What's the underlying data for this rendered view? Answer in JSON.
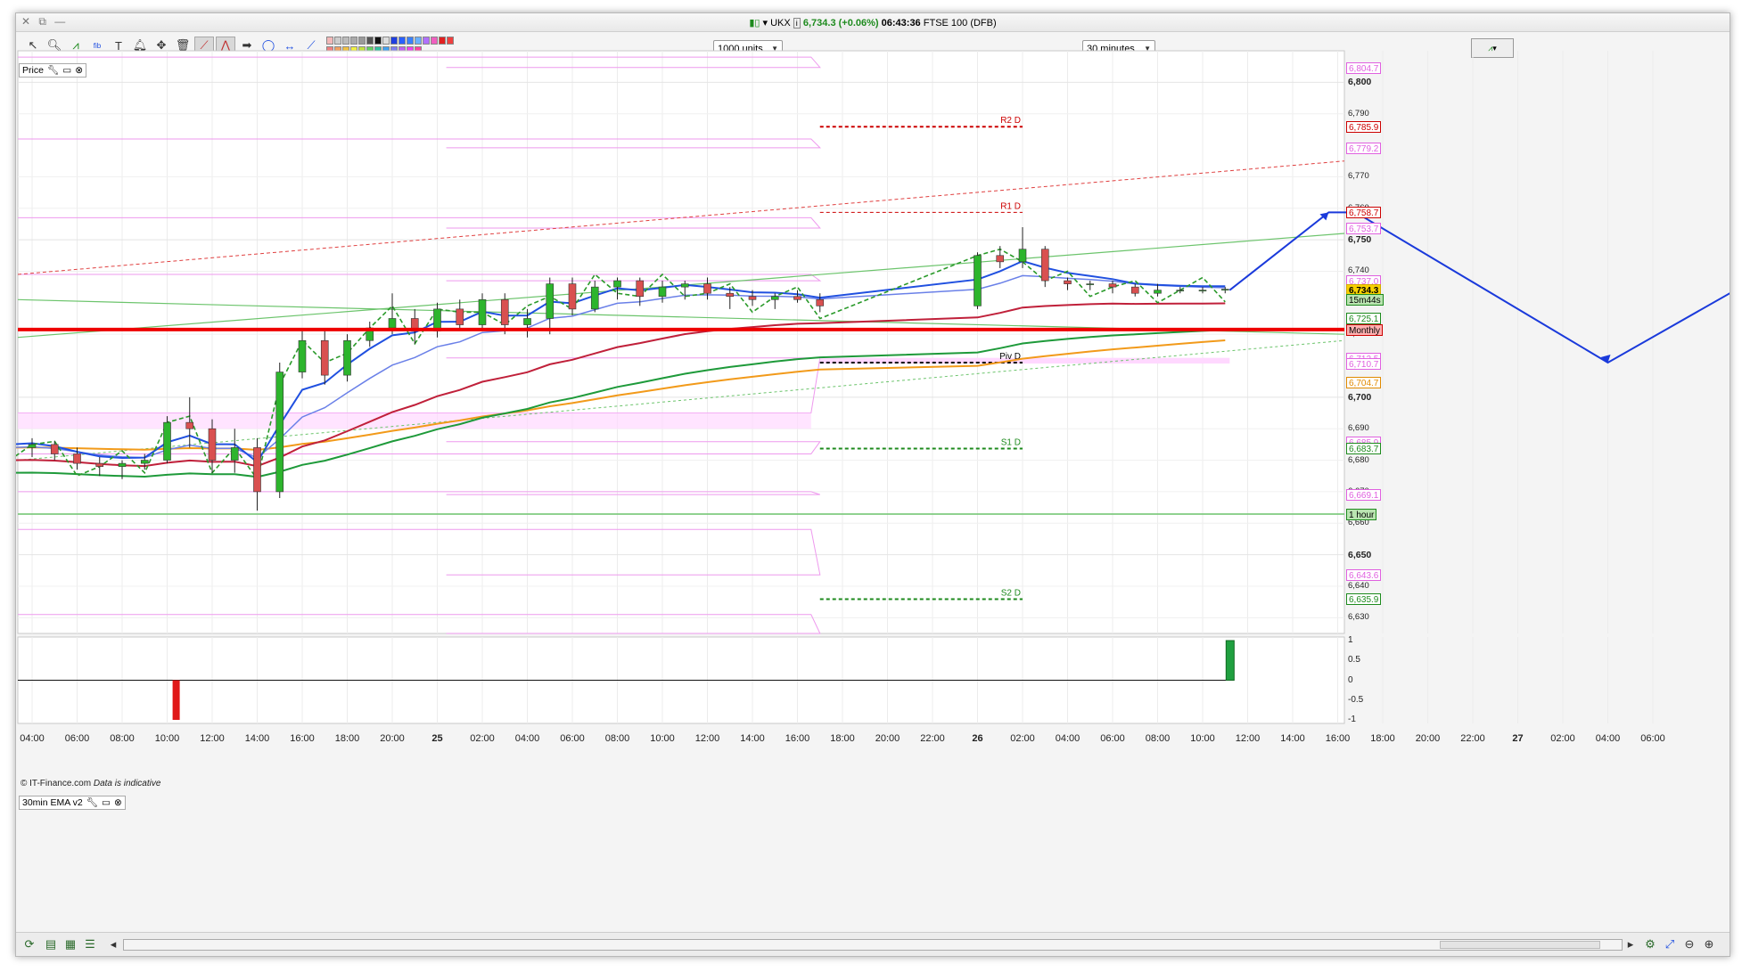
{
  "window": {
    "title_symbol": "UKX",
    "title_price": "6,734.3",
    "title_change": "(+0.06%)",
    "title_time": "06:43:36",
    "title_name": "FTSE 100 (DFB)"
  },
  "toolbar": {
    "units_select": "1000 units",
    "interval_select": "30 minutes"
  },
  "price_panel": {
    "label": "Price",
    "copyright": "© IT-Finance.com",
    "disclaimer": "Data is indicative"
  },
  "indicator_panel": {
    "label": "30min EMA v2",
    "ticks": [
      "1",
      "0.5",
      "0",
      "-0.5",
      "-1"
    ],
    "ylim": [
      -1,
      1
    ]
  },
  "price_axis": {
    "ylim": [
      6625,
      6810
    ],
    "major_ticks": [
      "6,800",
      "6,750",
      "6,700",
      "6,650"
    ],
    "minor_ticks": [
      "6,790",
      "6,770",
      "6,760",
      "6,740",
      "6,720",
      "6,690",
      "6,680",
      "6,670",
      "6,660",
      "6,640",
      "6,630"
    ],
    "major_values": [
      6800,
      6750,
      6700,
      6650
    ],
    "minor_values": [
      6790,
      6770,
      6760,
      6740,
      6720,
      6690,
      6680,
      6670,
      6660,
      6640,
      6630
    ],
    "tags": [
      {
        "text": "6,804.7",
        "value": 6804.7,
        "color": "#e060e0"
      },
      {
        "text": "6,785.9",
        "value": 6785.9,
        "color": "#cc0000"
      },
      {
        "text": "6,779.2",
        "value": 6779.2,
        "color": "#e060e0"
      },
      {
        "text": "6,758.7",
        "value": 6758.7,
        "color": "#cc0000"
      },
      {
        "text": "6,753.7",
        "value": 6753.7,
        "color": "#e060e0"
      },
      {
        "text": "6,737.0",
        "value": 6737.0,
        "color": "#e060e0"
      },
      {
        "text": "6,734.3",
        "value": 6734.3,
        "color": "#d4a800"
      },
      {
        "text": "15m44s",
        "value": 6731.0,
        "color": "#1d8a1d"
      },
      {
        "text": "6,725.1",
        "value": 6725.1,
        "color": "#1d8a1d"
      },
      {
        "text": "Monthly",
        "value": 6721.5,
        "color": "#cc0000"
      },
      {
        "text": "6,712.5",
        "value": 6712.5,
        "color": "#e060e0"
      },
      {
        "text": "6,710.7",
        "value": 6710.7,
        "color": "#e060e0"
      },
      {
        "text": "6,704.7",
        "value": 6704.7,
        "color": "#e08a00"
      },
      {
        "text": "6,685.9",
        "value": 6685.9,
        "color": "#e060e0"
      },
      {
        "text": "6,683.7",
        "value": 6683.7,
        "color": "#1d8a1d"
      },
      {
        "text": "6,669.1",
        "value": 6669.1,
        "color": "#e060e0"
      },
      {
        "text": "1 hour",
        "value": 6662.9,
        "color": "#1d8a1d"
      },
      {
        "text": "6,643.6",
        "value": 6643.6,
        "color": "#e060e0"
      },
      {
        "text": "6,635.9",
        "value": 6635.9,
        "color": "#1d8a1d"
      }
    ]
  },
  "pivots": [
    {
      "label": "R2 D",
      "value": 6785.9,
      "color": "#cc0000"
    },
    {
      "label": "R1 D",
      "value": 6758.7,
      "color": "#cc0000"
    },
    {
      "label": "Piv D",
      "value": 6711.0,
      "color": "#000000"
    },
    {
      "label": "S1 D",
      "value": 6683.7,
      "color": "#1d8a1d"
    },
    {
      "label": "S2 D",
      "value": 6635.9,
      "color": "#1d8a1d"
    }
  ],
  "time_axis": {
    "labels": [
      "04:00",
      "06:00",
      "08:00",
      "10:00",
      "12:00",
      "14:00",
      "16:00",
      "18:00",
      "20:00",
      "25",
      "02:00",
      "04:00",
      "06:00",
      "08:00",
      "10:00",
      "12:00",
      "14:00",
      "16:00",
      "18:00",
      "20:00",
      "22:00",
      "26",
      "02:00",
      "04:00",
      "06:00",
      "08:00",
      "10:00",
      "12:00",
      "14:00",
      "16:00",
      "18:00",
      "20:00",
      "22:00",
      "27",
      "02:00",
      "04:00",
      "06:00"
    ],
    "day_labels": [
      "25",
      "26",
      "27"
    ]
  },
  "colors": {
    "bull": "#2db52d",
    "bear": "#d95050",
    "monthly_line": "#ee0000",
    "forecast_arrow": "#1a3adb",
    "ema_fast": "#2050e0",
    "ema_slow": "#1e9a3a",
    "ema_long": "#f29a1a",
    "ema_red": "#c0203a",
    "pivot_band": "#ee99ee"
  },
  "chart_data": {
    "type": "candlestick",
    "candles": [
      {
        "t": "03:30",
        "o": 6686,
        "h": 6690,
        "l": 6682,
        "c": 6684
      },
      {
        "t": "04:00",
        "o": 6684,
        "h": 6687,
        "l": 6681,
        "c": 6685
      },
      {
        "t": "04:30",
        "o": 6685,
        "h": 6686,
        "l": 6680,
        "c": 6682
      },
      {
        "t": "05:00",
        "o": 6682,
        "h": 6684,
        "l": 6677,
        "c": 6679
      },
      {
        "t": "05:30",
        "o": 6679,
        "h": 6681,
        "l": 6675,
        "c": 6678
      },
      {
        "t": "06:00",
        "o": 6678,
        "h": 6680,
        "l": 6674,
        "c": 6679
      },
      {
        "t": "06:30",
        "o": 6679,
        "h": 6682,
        "l": 6677,
        "c": 6680
      },
      {
        "t": "07:00",
        "o": 6680,
        "h": 6694,
        "l": 6679,
        "c": 6692
      },
      {
        "t": "07:30",
        "o": 6692,
        "h": 6700,
        "l": 6684,
        "c": 6690
      },
      {
        "t": "08:00",
        "o": 6690,
        "h": 6693,
        "l": 6676,
        "c": 6680
      },
      {
        "t": "08:30",
        "o": 6680,
        "h": 6690,
        "l": 6676,
        "c": 6684
      },
      {
        "t": "09:00",
        "o": 6684,
        "h": 6687,
        "l": 6664,
        "c": 6670
      },
      {
        "t": "09:30",
        "o": 6670,
        "h": 6711,
        "l": 6668,
        "c": 6708
      },
      {
        "t": "10:00",
        "o": 6708,
        "h": 6721,
        "l": 6706,
        "c": 6718
      },
      {
        "t": "10:30",
        "o": 6718,
        "h": 6722,
        "l": 6704,
        "c": 6707
      },
      {
        "t": "11:00",
        "o": 6707,
        "h": 6720,
        "l": 6705,
        "c": 6718
      },
      {
        "t": "11:30",
        "o": 6718,
        "h": 6724,
        "l": 6716,
        "c": 6722
      },
      {
        "t": "12:00",
        "o": 6722,
        "h": 6733,
        "l": 6720,
        "c": 6725
      },
      {
        "t": "12:30",
        "o": 6725,
        "h": 6728,
        "l": 6717,
        "c": 6721
      },
      {
        "t": "13:00",
        "o": 6721,
        "h": 6730,
        "l": 6719,
        "c": 6728
      },
      {
        "t": "13:30",
        "o": 6728,
        "h": 6731,
        "l": 6722,
        "c": 6723
      },
      {
        "t": "14:00",
        "o": 6723,
        "h": 6733,
        "l": 6721,
        "c": 6731
      },
      {
        "t": "14:30",
        "o": 6731,
        "h": 6733,
        "l": 6720,
        "c": 6723
      },
      {
        "t": "15:00",
        "o": 6723,
        "h": 6728,
        "l": 6719,
        "c": 6725
      },
      {
        "t": "15:30",
        "o": 6725,
        "h": 6738,
        "l": 6720,
        "c": 6736
      },
      {
        "t": "16:00",
        "o": 6736,
        "h": 6738,
        "l": 6726,
        "c": 6728
      },
      {
        "t": "16:30",
        "o": 6728,
        "h": 6737,
        "l": 6727,
        "c": 6735
      },
      {
        "t": "17:00",
        "o": 6735,
        "h": 6738,
        "l": 6731,
        "c": 6737
      },
      {
        "t": "17:30",
        "o": 6737,
        "h": 6738,
        "l": 6729,
        "c": 6732
      },
      {
        "t": "18:00",
        "o": 6732,
        "h": 6737,
        "l": 6730,
        "c": 6735
      },
      {
        "t": "18:30",
        "o": 6735,
        "h": 6737,
        "l": 6731,
        "c": 6736
      },
      {
        "t": "19:00",
        "o": 6736,
        "h": 6738,
        "l": 6731,
        "c": 6733
      },
      {
        "t": "19:30",
        "o": 6733,
        "h": 6735,
        "l": 6728,
        "c": 6732
      },
      {
        "t": "20:00",
        "o": 6732,
        "h": 6734,
        "l": 6729,
        "c": 6731
      },
      {
        "t": "20:30",
        "o": 6731,
        "h": 6733,
        "l": 6728,
        "c": 6732
      },
      {
        "t": "21:00",
        "o": 6732,
        "h": 6734,
        "l": 6730,
        "c": 6731
      },
      {
        "t": "21:30",
        "o": 6731,
        "h": 6733,
        "l": 6727,
        "c": 6729
      },
      {
        "t": "01:00",
        "o": 6729,
        "h": 6746,
        "l": 6728,
        "c": 6745
      },
      {
        "t": "01:30",
        "o": 6745,
        "h": 6748,
        "l": 6741,
        "c": 6743
      },
      {
        "t": "02:00",
        "o": 6743,
        "h": 6754,
        "l": 6741,
        "c": 6747
      },
      {
        "t": "02:30",
        "o": 6747,
        "h": 6748,
        "l": 6735,
        "c": 6737
      },
      {
        "t": "03:00",
        "o": 6737,
        "h": 6738,
        "l": 6734,
        "c": 6736
      },
      {
        "t": "03:30",
        "o": 6736,
        "h": 6737,
        "l": 6734,
        "c": 6736
      },
      {
        "t": "04:00",
        "o": 6736,
        "h": 6737,
        "l": 6733,
        "c": 6735
      },
      {
        "t": "04:30",
        "o": 6735,
        "h": 6736,
        "l": 6732,
        "c": 6733
      },
      {
        "t": "05:00",
        "o": 6733,
        "h": 6736,
        "l": 6732,
        "c": 6734
      },
      {
        "t": "05:30",
        "o": 6734,
        "h": 6735,
        "l": 6733,
        "c": 6734
      },
      {
        "t": "06:00",
        "o": 6734,
        "h": 6735,
        "l": 6733,
        "c": 6734
      },
      {
        "t": "06:30",
        "o": 6734,
        "h": 6735,
        "l": 6733,
        "c": 6734.3
      }
    ],
    "indicator_bars": [
      {
        "t": "07:30",
        "value": -1
      },
      {
        "t": "06:30",
        "value": 1
      }
    ]
  }
}
